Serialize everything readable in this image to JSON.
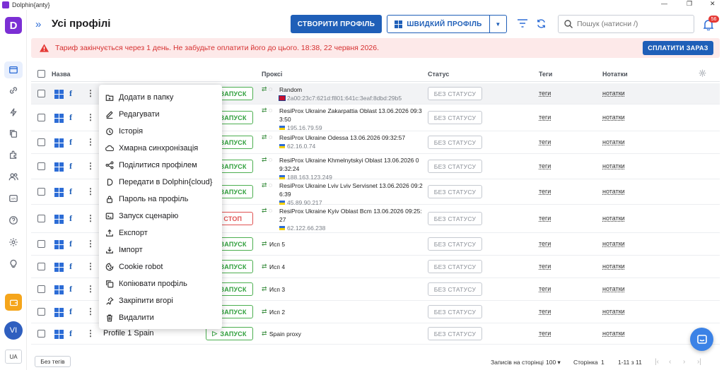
{
  "window": {
    "title": "Dolphin{anty}"
  },
  "header": {
    "title": "Усі профілі",
    "create_button": "СТВОРИТИ ПРОФІЛЬ",
    "quick_button": "ШВИДКИЙ ПРОФІЛЬ",
    "search_placeholder": "Пошук (натисни /)",
    "notification_count": "56"
  },
  "banner": {
    "text": "Тариф закінчується через 1 день. Не забудьте оплатити його до цього. 18:38, 22 червня 2026.",
    "pay_button": "СПЛАТИТИ ЗАРАЗ"
  },
  "table": {
    "columns": {
      "name": "Назва",
      "proxy": "Проксі",
      "status": "Статус",
      "tags": "Теги",
      "notes": "Нотатки"
    },
    "rows": [
      {
        "name": "",
        "action": "ЗАПУСК",
        "proxy_line1": "Random",
        "proxy_line2": "",
        "proxy_sub": "2a00:23c7:621d:f801:641c:3eaf:8dbd:29b5",
        "flag": "uk",
        "status": "БЕЗ СТАТУСУ",
        "tags": "теги",
        "notes": "нотатки"
      },
      {
        "name": "",
        "action": "ЗАПУСК",
        "proxy_line1": "ResiProx Ukraine Zakarpattia Oblast 13.06.2026 09:3",
        "proxy_line2": "3:50",
        "proxy_sub": "195.16.79.59",
        "flag": "ua",
        "status": "БЕЗ СТАТУСУ",
        "tags": "теги",
        "notes": "нотатки"
      },
      {
        "name": "",
        "action": "ЗАПУСК",
        "proxy_line1": "ResiProx Ukraine Odessa 13.06.2026 09:32:57",
        "proxy_line2": "",
        "proxy_sub": "62.16.0.74",
        "flag": "ua",
        "status": "БЕЗ СТАТУСУ",
        "tags": "теги",
        "notes": "нотатки"
      },
      {
        "name": "",
        "action": "ЗАПУСК",
        "proxy_line1": "ResiProx Ukraine Khmelnytskyi Oblast 13.06.2026 0",
        "proxy_line2": "9:32:24",
        "proxy_sub": "188.163.123.249",
        "flag": "ua",
        "status": "БЕЗ СТАТУСУ",
        "tags": "теги",
        "notes": "нотатки"
      },
      {
        "name": "",
        "action": "ЗАПУСК",
        "proxy_line1": "ResiProx Ukraine Lviv Lviv Servisnet 13.06.2026 09:2",
        "proxy_line2": "6:39",
        "proxy_sub": "45.89.90.217",
        "flag": "ua",
        "status": "БЕЗ СТАТУСУ",
        "tags": "теги",
        "notes": "нотатки"
      },
      {
        "name": "",
        "action": "СТОП",
        "proxy_line1": "ResiProx Ukraine Kyiv Oblast Bcm 13.06.2026 09:25:",
        "proxy_line2": "27",
        "proxy_sub": "62.122.66.238",
        "flag": "ua",
        "status": "БЕЗ СТАТУСУ",
        "tags": "теги",
        "notes": "нотатки"
      },
      {
        "name": "",
        "action": "ЗАПУСК",
        "proxy_line1": "Исп 5",
        "proxy_line2": "",
        "proxy_sub": "",
        "flag": "",
        "status": "БЕЗ СТАТУСУ",
        "tags": "теги",
        "notes": "нотатки"
      },
      {
        "name": "",
        "action": "ЗАПУСК",
        "proxy_line1": "Исп 4",
        "proxy_line2": "",
        "proxy_sub": "",
        "flag": "",
        "status": "БЕЗ СТАТУСУ",
        "tags": "теги",
        "notes": "нотатки"
      },
      {
        "name": "",
        "action": "ЗАПУСК",
        "proxy_line1": "Исп 3",
        "proxy_line2": "",
        "proxy_sub": "",
        "flag": "",
        "status": "БЕЗ СТАТУСУ",
        "tags": "теги",
        "notes": "нотатки"
      },
      {
        "name": "",
        "action": "ЗАПУСК",
        "proxy_line1": "Исп 2",
        "proxy_line2": "",
        "proxy_sub": "",
        "flag": "",
        "status": "БЕЗ СТАТУСУ",
        "tags": "теги",
        "notes": "нотатки"
      },
      {
        "name": "Profile 1 Spain",
        "action": "ЗАПУСК",
        "proxy_line1": "Spain proxy",
        "proxy_line2": "",
        "proxy_sub": "",
        "flag": "",
        "status": "БЕЗ СТАТУСУ",
        "tags": "теги",
        "notes": "нотатки"
      }
    ]
  },
  "context_menu": {
    "items": [
      {
        "label": "Додати в папку",
        "icon": "folder-plus-icon"
      },
      {
        "label": "Редагувати",
        "icon": "edit-icon"
      },
      {
        "label": "Історія",
        "icon": "history-icon"
      },
      {
        "label": "Хмарна синхронізація",
        "icon": "cloud-icon"
      },
      {
        "label": "Поділитися профілем",
        "icon": "share-icon"
      },
      {
        "label": "Передати в Dolphin{cloud}",
        "icon": "dolphin-icon"
      },
      {
        "label": "Пароль на профіль",
        "icon": "lock-icon"
      },
      {
        "label": "Запуск сценарію",
        "icon": "script-icon"
      },
      {
        "label": "Експорт",
        "icon": "export-icon"
      },
      {
        "label": "Імпорт",
        "icon": "import-icon"
      },
      {
        "label": "Cookie robot",
        "icon": "cookie-icon"
      },
      {
        "label": "Копіювати профіль",
        "icon": "copy-icon"
      },
      {
        "label": "Закріпити вгорі",
        "icon": "pin-icon"
      },
      {
        "label": "Видалити",
        "icon": "trash-icon"
      }
    ]
  },
  "sidebar": {
    "avatar_initials": "VI",
    "language": "UA"
  },
  "footer": {
    "no_tags": "Без тегів",
    "per_page_label": "Записів на сторінці",
    "per_page_value": "100",
    "page_label": "Сторінка",
    "page_value": "1",
    "range": "1-11 з 11"
  },
  "colors": {
    "primary": "#1f5fb8",
    "brand": "#7b2fd4",
    "danger": "#e05252",
    "success": "#2e9e3a",
    "banner_bg": "#fde9e9"
  }
}
